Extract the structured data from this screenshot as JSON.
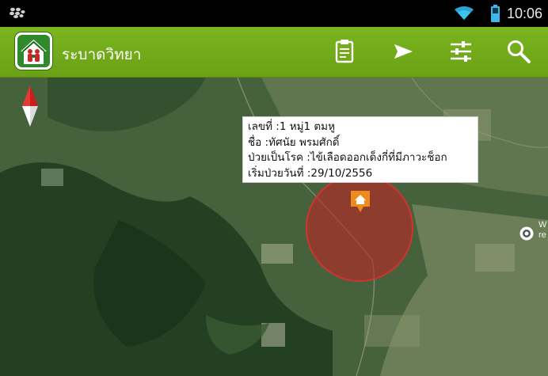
{
  "status_bar": {
    "time": "10:06",
    "icons": [
      "blackberry-icon",
      "wifi-icon",
      "battery-icon"
    ]
  },
  "action_bar": {
    "app_title": "ระบาดวิทยา",
    "logo_icon": "house-family-icon",
    "actions": [
      "clipboard-icon",
      "send-icon",
      "sliders-icon",
      "search-icon"
    ],
    "color": "#6fa71a"
  },
  "map": {
    "compass": "north-arrow-icon",
    "zone_color": "#c02828",
    "popup": {
      "line1": "เลขที่ :1 หมู่1 ตมหู",
      "line2": "ชื่อ :ทัศนัย พรมศักดิ์",
      "line3": "ป่วยเป็นโรค :ไข้เลือดออกเด็งกี่ที่มีภาวะช็อก",
      "line4": "เริ่มป่วยวันที่ :29/10/2556"
    },
    "poi_label": "W\nre"
  }
}
